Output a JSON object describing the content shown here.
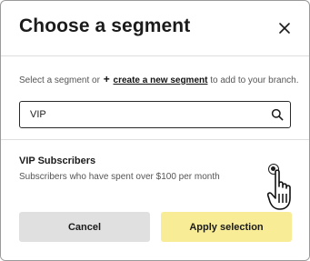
{
  "modal": {
    "title": "Choose a segment",
    "close_icon": "close-icon"
  },
  "helper": {
    "prefix": "Select a segment or",
    "plus": "+",
    "link": "create a new segment",
    "suffix": "to add to your branch."
  },
  "search": {
    "value": "VIP",
    "icon": "search-icon"
  },
  "segments": [
    {
      "name": "VIP Subscribers",
      "description": "Subscribers who have spent over $100 per month",
      "selected": true
    }
  ],
  "footer": {
    "cancel_label": "Cancel",
    "apply_label": "Apply selection"
  },
  "colors": {
    "apply_button": "#f8ec96",
    "cancel_button": "#e0e0e0",
    "text": "#1b1b1b"
  }
}
